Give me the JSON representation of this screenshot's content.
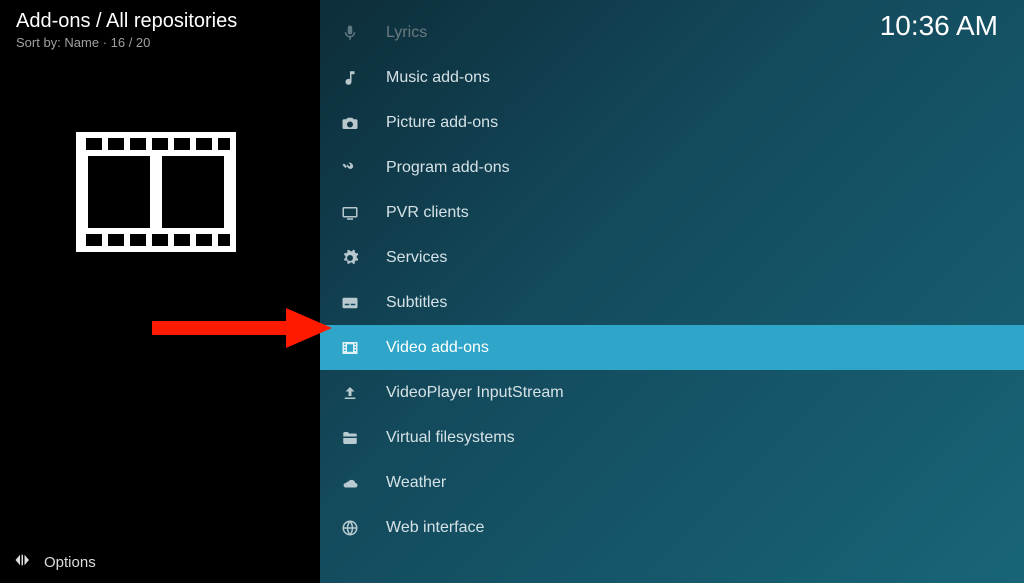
{
  "header": {
    "breadcrumb": "Add-ons / All repositories",
    "sort_line": "Sort by: Name  ·  16 / 20"
  },
  "clock": "10:36 AM",
  "list": [
    {
      "label": "Lyrics",
      "icon": "mic-icon",
      "dim": true
    },
    {
      "label": "Music add-ons",
      "icon": "music-icon"
    },
    {
      "label": "Picture add-ons",
      "icon": "camera-icon"
    },
    {
      "label": "Program add-ons",
      "icon": "tools-icon"
    },
    {
      "label": "PVR clients",
      "icon": "tv-icon"
    },
    {
      "label": "Services",
      "icon": "gear-icon"
    },
    {
      "label": "Subtitles",
      "icon": "subtitle-icon"
    },
    {
      "label": "Video add-ons",
      "icon": "film-icon",
      "selected": true
    },
    {
      "label": "VideoPlayer InputStream",
      "icon": "upload-icon"
    },
    {
      "label": "Virtual filesystems",
      "icon": "folder-icon"
    },
    {
      "label": "Weather",
      "icon": "weather-icon"
    },
    {
      "label": "Web interface",
      "icon": "globe-icon"
    }
  ],
  "footer": {
    "options_label": "Options"
  }
}
